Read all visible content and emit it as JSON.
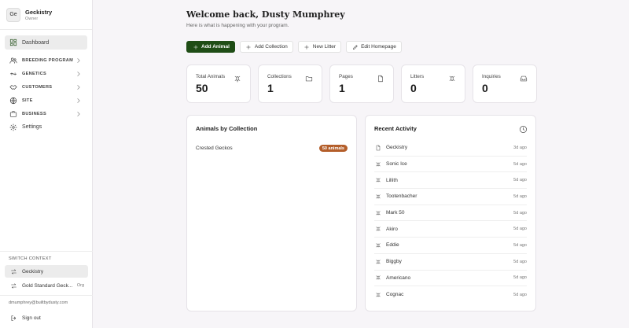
{
  "org": {
    "initials": "Ge",
    "name": "Geckistry",
    "role": "Owner"
  },
  "nav": {
    "dashboard": "Dashboard",
    "sections": [
      {
        "label": "BREEDING PROGRAM",
        "icon": "users-icon"
      },
      {
        "label": "GENETICS",
        "icon": "dna-icon"
      },
      {
        "label": "CUSTOMERS",
        "icon": "handshake-icon"
      },
      {
        "label": "SITE",
        "icon": "globe-icon"
      },
      {
        "label": "BUSINESS",
        "icon": "briefcase-icon"
      }
    ],
    "settings": "Settings"
  },
  "switch_context": {
    "title": "SWITCH CONTEXT",
    "items": [
      {
        "label": "Geckistry",
        "tag": ""
      },
      {
        "label": "Gold Standard Geck...",
        "tag": "Org"
      }
    ]
  },
  "user": {
    "email": "dmumphrey@builtbydusty.com",
    "signout": "Sign out"
  },
  "header": {
    "welcome": "Welcome back, Dusty Mumphrey",
    "subtitle": "Here is what is happening with your program."
  },
  "actions": {
    "add_animal": "Add Animal",
    "add_collection": "Add Collection",
    "new_litter": "New Litter",
    "edit_homepage": "Edit Homepage"
  },
  "stats": [
    {
      "label": "Total Animals",
      "value": "50",
      "icon": "gecko-icon"
    },
    {
      "label": "Collections",
      "value": "1",
      "icon": "folder-icon"
    },
    {
      "label": "Pages",
      "value": "1",
      "icon": "page-icon"
    },
    {
      "label": "Litters",
      "value": "0",
      "icon": "egg-icon"
    },
    {
      "label": "Inquiries",
      "value": "0",
      "icon": "inbox-icon"
    }
  ],
  "collections": {
    "title": "Animals by Collection",
    "rows": [
      {
        "name": "Crested Geckos",
        "badge": "50 animals"
      }
    ]
  },
  "activity": {
    "title": "Recent Activity",
    "rows": [
      {
        "name": "Geckistry",
        "time": "3d ago",
        "icon": "page-icon"
      },
      {
        "name": "Sonic Ice",
        "time": "5d ago",
        "icon": "gecko-icon"
      },
      {
        "name": "Lillith",
        "time": "5d ago",
        "icon": "gecko-icon"
      },
      {
        "name": "Tootenbacher",
        "time": "5d ago",
        "icon": "gecko-icon"
      },
      {
        "name": "Mark 50",
        "time": "5d ago",
        "icon": "gecko-icon"
      },
      {
        "name": "Akiro",
        "time": "5d ago",
        "icon": "gecko-icon"
      },
      {
        "name": "Eddie",
        "time": "5d ago",
        "icon": "gecko-icon"
      },
      {
        "name": "Biggby",
        "time": "5d ago",
        "icon": "gecko-icon"
      },
      {
        "name": "Americano",
        "time": "5d ago",
        "icon": "gecko-icon"
      },
      {
        "name": "Cognac",
        "time": "5d ago",
        "icon": "gecko-icon"
      }
    ]
  },
  "colors": {
    "primary": "#1f4d16",
    "badge": "#b45e2a",
    "background": "#f7f5f8"
  }
}
